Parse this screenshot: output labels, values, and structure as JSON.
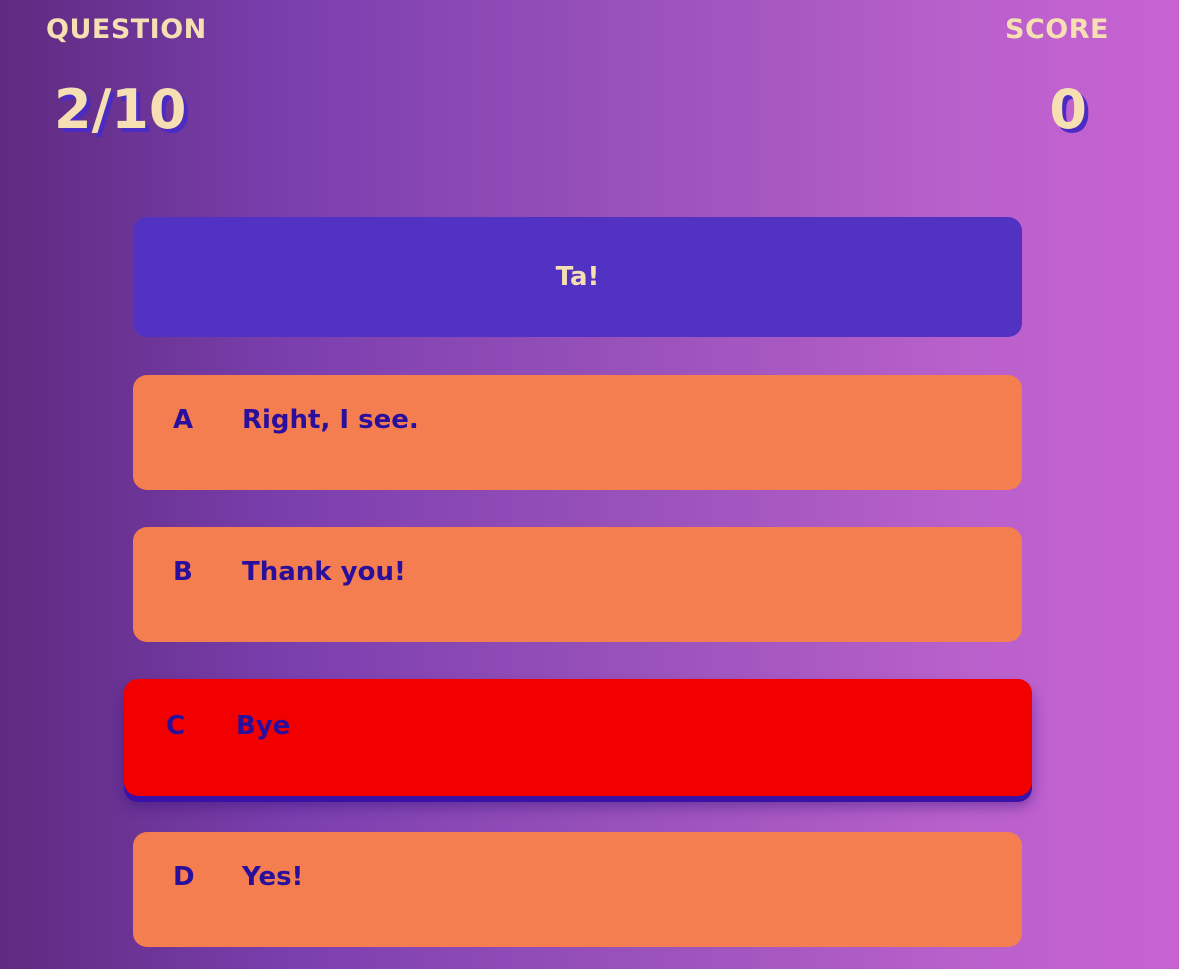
{
  "hud": {
    "question_label": "QUESTION",
    "question_value": "2/10",
    "score_label": "SCORE",
    "score_value": "0"
  },
  "question": {
    "text": "Ta!"
  },
  "answers": [
    {
      "letter": "A",
      "text": "Right, I see."
    },
    {
      "letter": "B",
      "text": "Thank you!"
    },
    {
      "letter": "C",
      "text": "Bye",
      "state": "incorrect"
    },
    {
      "letter": "D",
      "text": "Yes!"
    }
  ],
  "colors": {
    "background_start": "#5f2a80",
    "background_end": "#c862d3",
    "hud_text": "#f5dfb3",
    "question_card": "#5132c2",
    "answer_default": "#f57e50",
    "answer_incorrect": "#f20000",
    "answer_text": "#2a0f9c"
  }
}
